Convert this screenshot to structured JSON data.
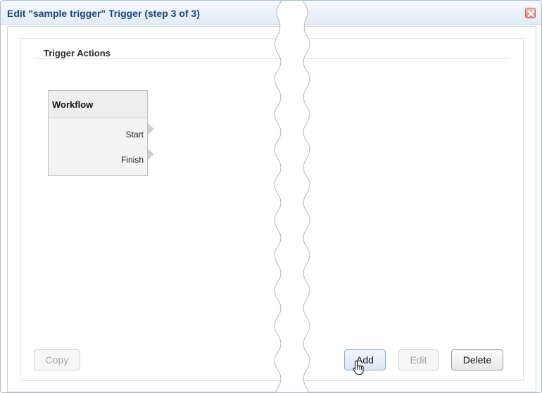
{
  "dialog": {
    "title": "Edit \"sample trigger\" Trigger (step 3 of 3)",
    "close_icon": "close-icon"
  },
  "section": {
    "title": "Trigger Actions"
  },
  "workflow": {
    "title": "Workflow",
    "ports": [
      "Start",
      "Finish"
    ]
  },
  "buttons": {
    "copy": "Copy",
    "add": "Add",
    "edit": "Edit",
    "delete": "Delete"
  },
  "colors": {
    "title_text": "#1d4478",
    "close_button": "#e6817a",
    "add_hover": "#dbe6f6"
  }
}
